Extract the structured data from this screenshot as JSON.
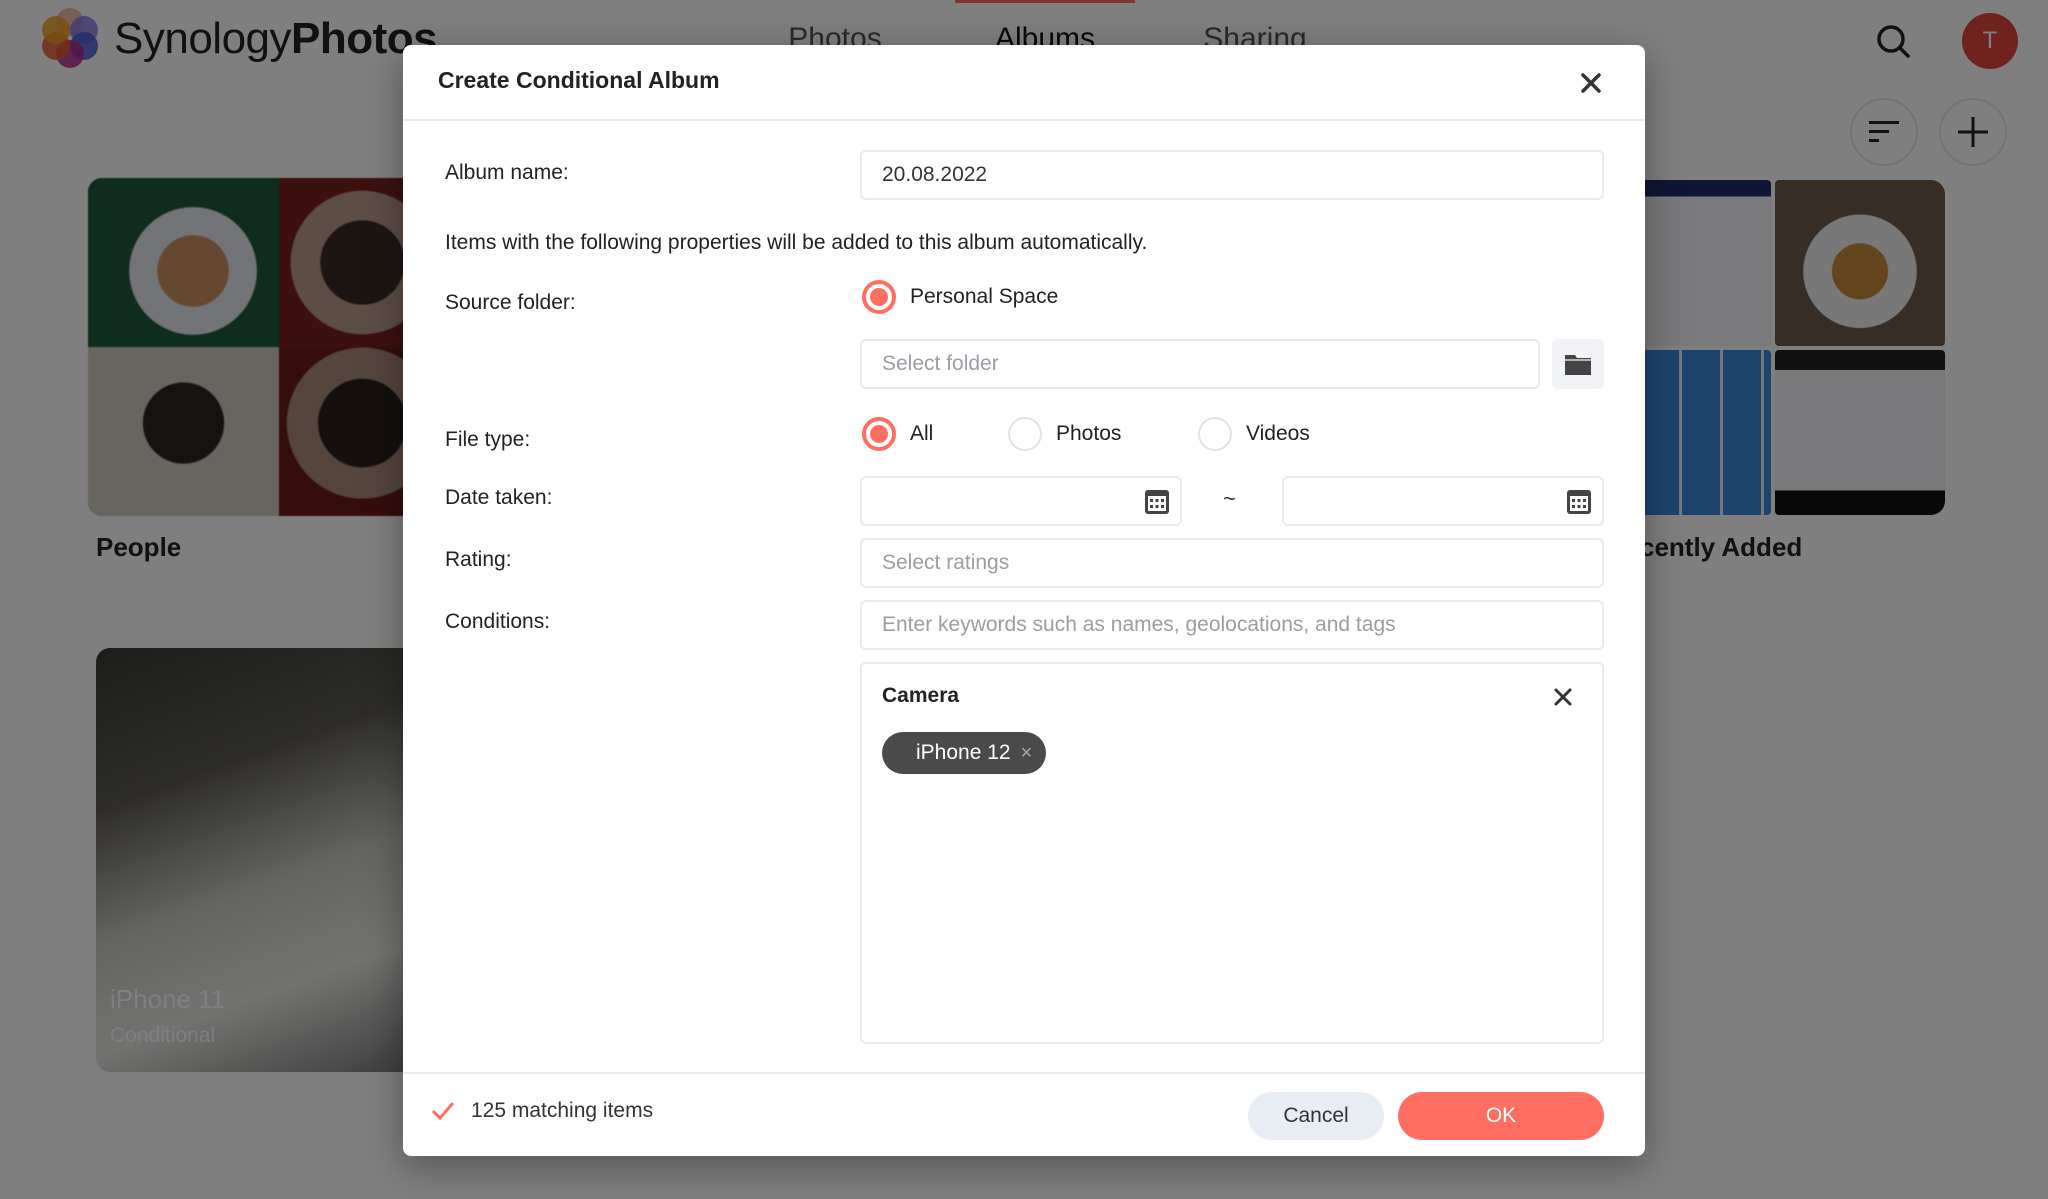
{
  "app": {
    "brand_light": "Synology",
    "brand_bold": "Photos",
    "nav_tabs": [
      {
        "label": "Photos",
        "active": false
      },
      {
        "label": "Albums",
        "active": true
      },
      {
        "label": "Sharing",
        "active": false
      }
    ],
    "avatar_initial": "T",
    "accent_color": "#ff6f61",
    "albums": [
      {
        "title": "People"
      },
      {
        "title": "Recently Added",
        "visible_title": "cently Added"
      },
      {
        "title": "iPhone 11",
        "subtitle": "Conditional"
      }
    ],
    "icons": {
      "search": "search-icon",
      "sort": "sort-icon",
      "add": "plus-icon"
    }
  },
  "dialog": {
    "title": "Create Conditional Album",
    "close_icon": "close-icon",
    "album_name_label": "Album name:",
    "album_name_value": "20.08.2022",
    "description": "Items with the following properties will be added to this album automatically.",
    "source_folder_label": "Source folder:",
    "source_option": "Personal Space",
    "select_folder_placeholder": "Select folder",
    "file_type_label": "File type:",
    "file_types": [
      {
        "label": "All",
        "selected": true
      },
      {
        "label": "Photos",
        "selected": false
      },
      {
        "label": "Videos",
        "selected": false
      }
    ],
    "date_taken_label": "Date taken:",
    "date_from": "",
    "date_to": "",
    "date_separator": "~",
    "rating_label": "Rating:",
    "rating_placeholder": "Select ratings",
    "conditions_label": "Conditions:",
    "conditions_placeholder": "Enter keywords such as names, geolocations, and tags",
    "condition_group": {
      "title": "Camera",
      "chips": [
        {
          "label": "iPhone 12",
          "remove": "×"
        }
      ]
    },
    "footer": {
      "match_text": "125 matching items",
      "cancel_label": "Cancel",
      "ok_label": "OK"
    }
  }
}
